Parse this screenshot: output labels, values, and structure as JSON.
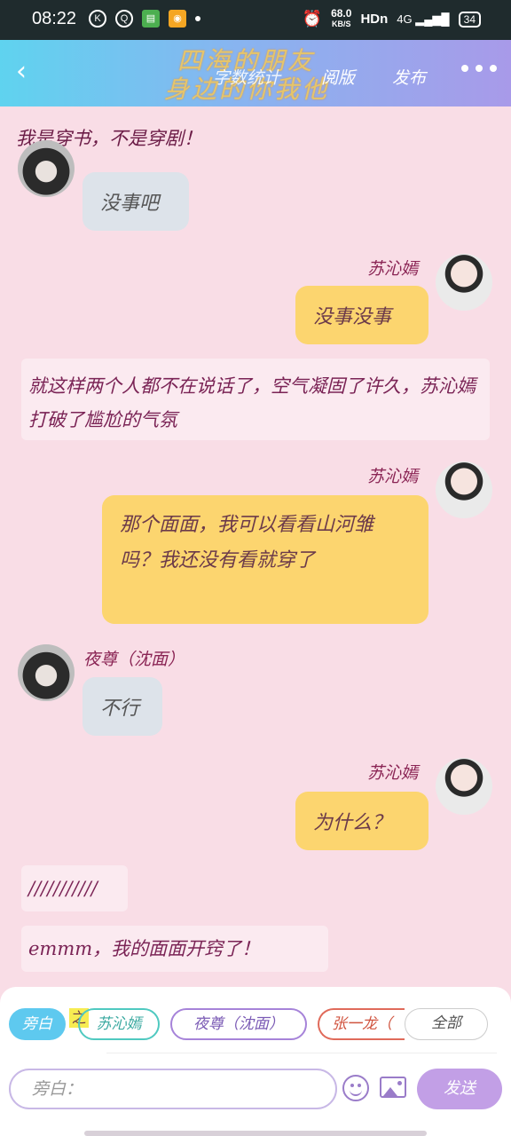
{
  "statusbar": {
    "time": "08:22",
    "speed_value": "68.0",
    "speed_unit": "KB/S",
    "network": "HDn",
    "signal": "4G",
    "battery": "34"
  },
  "header": {
    "title_line1": "四海的朋友",
    "title_line2": "身边的你我他",
    "nav_wordcount": "字数统计",
    "nav_typeset": "阅版",
    "nav_publish": "发布"
  },
  "messages": {
    "narr_top": "我是穿书，不是穿剧！",
    "m1_text": "没事吧",
    "m2_name": "苏沁嫣",
    "m2_text": "没事没事",
    "narr2": "就这样两个人都不在说话了，空气凝固了许久，苏沁嫣打破了尴尬的气氛",
    "m3_name": "苏沁嫣",
    "m3_text": "那个面面，我可以看看山河雏吗？我还没有看就穿了",
    "m4_name": "夜尊（沈面）",
    "m4_text": "不行",
    "m5_name": "苏沁嫣",
    "m5_text": "为什么？",
    "narr3": "///////////",
    "narr4": "emmm，我的面面开窍了！"
  },
  "input": {
    "chip_narr": "旁白",
    "zhi": "之",
    "chip_a": "苏沁嫣",
    "chip_b": "夜尊（沈面）",
    "chip_c": "张一龙（",
    "chip_all": "全部",
    "placeholder": "旁白：",
    "send": "发送"
  },
  "colors": {
    "background": "#f9dde6",
    "bubble_self": "#fcd56f",
    "bubble_other": "#dde3ea",
    "accent": "#c29fe6"
  }
}
